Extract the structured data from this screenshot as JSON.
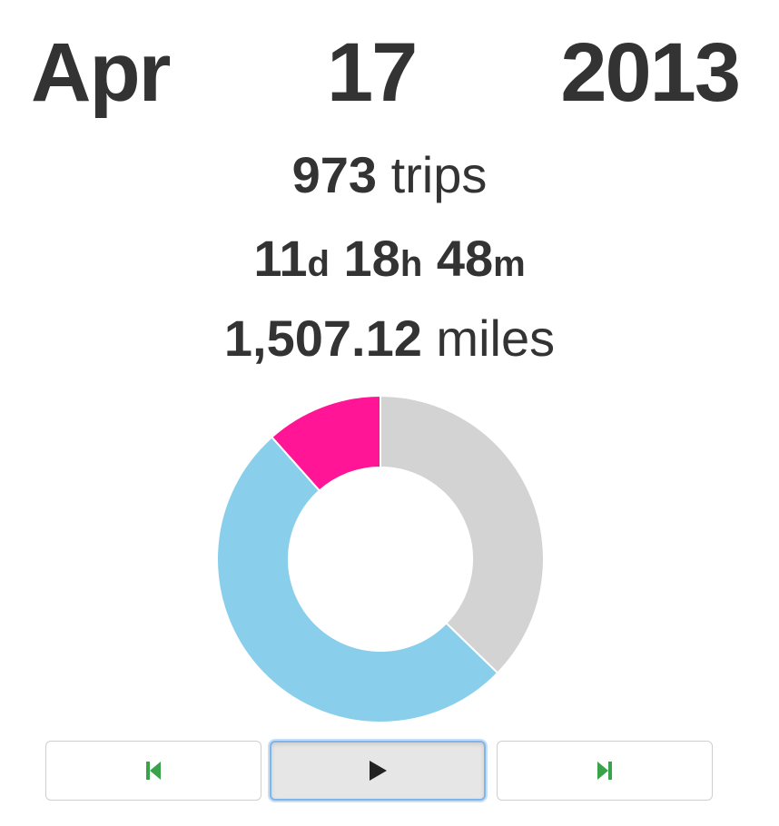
{
  "date": {
    "month": "Apr",
    "day": "17",
    "year": "2013"
  },
  "stats": {
    "trips_value": "973",
    "trips_label": " trips",
    "duration": {
      "days_value": "11",
      "days_unit": "d",
      "hours_value": "18",
      "hours_unit": "h",
      "minutes_value": "48",
      "minutes_unit": "m"
    },
    "miles_value": "1,507.12",
    "miles_label": " miles"
  },
  "donut": {
    "segments": [
      {
        "fraction": 0.3727,
        "color": "#d3d3d3"
      },
      {
        "fraction": 0.5116,
        "color": "#89cfeb"
      },
      {
        "fraction": 0.1157,
        "color": "#ff1595"
      }
    ]
  },
  "controls": {
    "prev_icon": "skip-previous-icon",
    "play_icon": "play-icon",
    "next_icon": "skip-next-icon",
    "icon_color_green": "#3aa34a",
    "icon_color_dark": "#222222"
  }
}
